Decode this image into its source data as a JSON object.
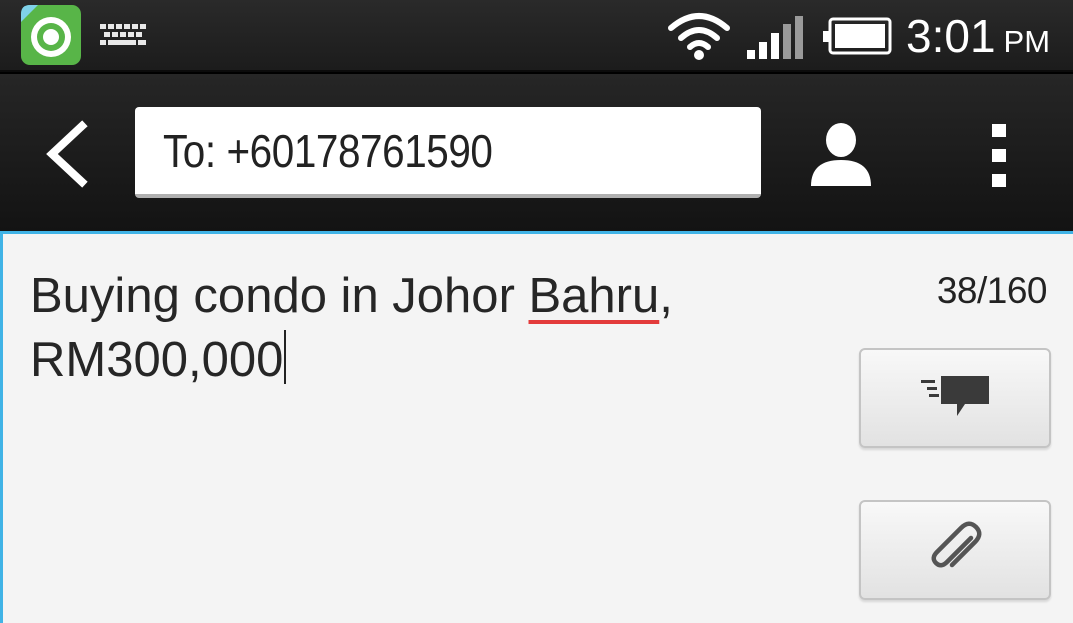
{
  "status_bar": {
    "time": "3:01",
    "ampm": "PM",
    "icons": [
      "app-notification-icon",
      "keyboard-icon",
      "wifi-icon",
      "signal-icon",
      "battery-icon"
    ]
  },
  "action_bar": {
    "recipient": "To: +60178761590",
    "icons": [
      "back-icon",
      "person-icon",
      "overflow-menu-icon"
    ]
  },
  "compose": {
    "message_before_underline": "Buying condo in Johor ",
    "message_misspelled_word": "Bahru",
    "message_after_underline": ",\nRM300,000",
    "char_count": "38/160",
    "buttons": [
      "send-icon",
      "attach-icon"
    ]
  },
  "colors": {
    "accent": "#40b3e6",
    "spellcheck_underline": "#e33b3b",
    "app_icon_green": "#4caf50"
  }
}
